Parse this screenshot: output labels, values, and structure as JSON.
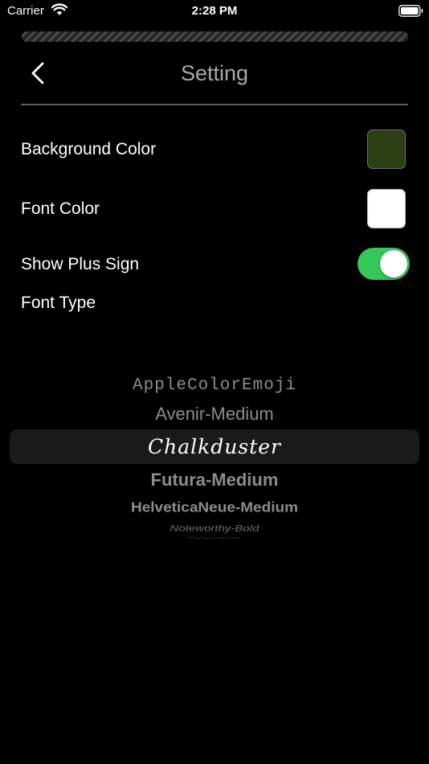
{
  "status_bar": {
    "carrier": "Carrier",
    "time": "2:28 PM",
    "icons": [
      "wifi-icon",
      "battery-icon"
    ]
  },
  "header": {
    "back_icon": "chevron-left-icon",
    "title": "Setting"
  },
  "settings": {
    "background_color": {
      "label": "Background Color",
      "value": "#2b3e14"
    },
    "font_color": {
      "label": "Font Color",
      "value": "#ffffff"
    },
    "show_plus_sign": {
      "label": "Show Plus Sign",
      "enabled": true,
      "on_color": "#34c759"
    },
    "font_type": {
      "label": "Font Type",
      "options": [
        "AppleColorEmoji",
        "Avenir-Medium",
        "Chalkduster",
        "Futura-Medium",
        "HelveticaNeue-Medium",
        "Noteworthy-Bold",
        "PartyLetPlain"
      ],
      "selected": "Chalkduster"
    }
  }
}
